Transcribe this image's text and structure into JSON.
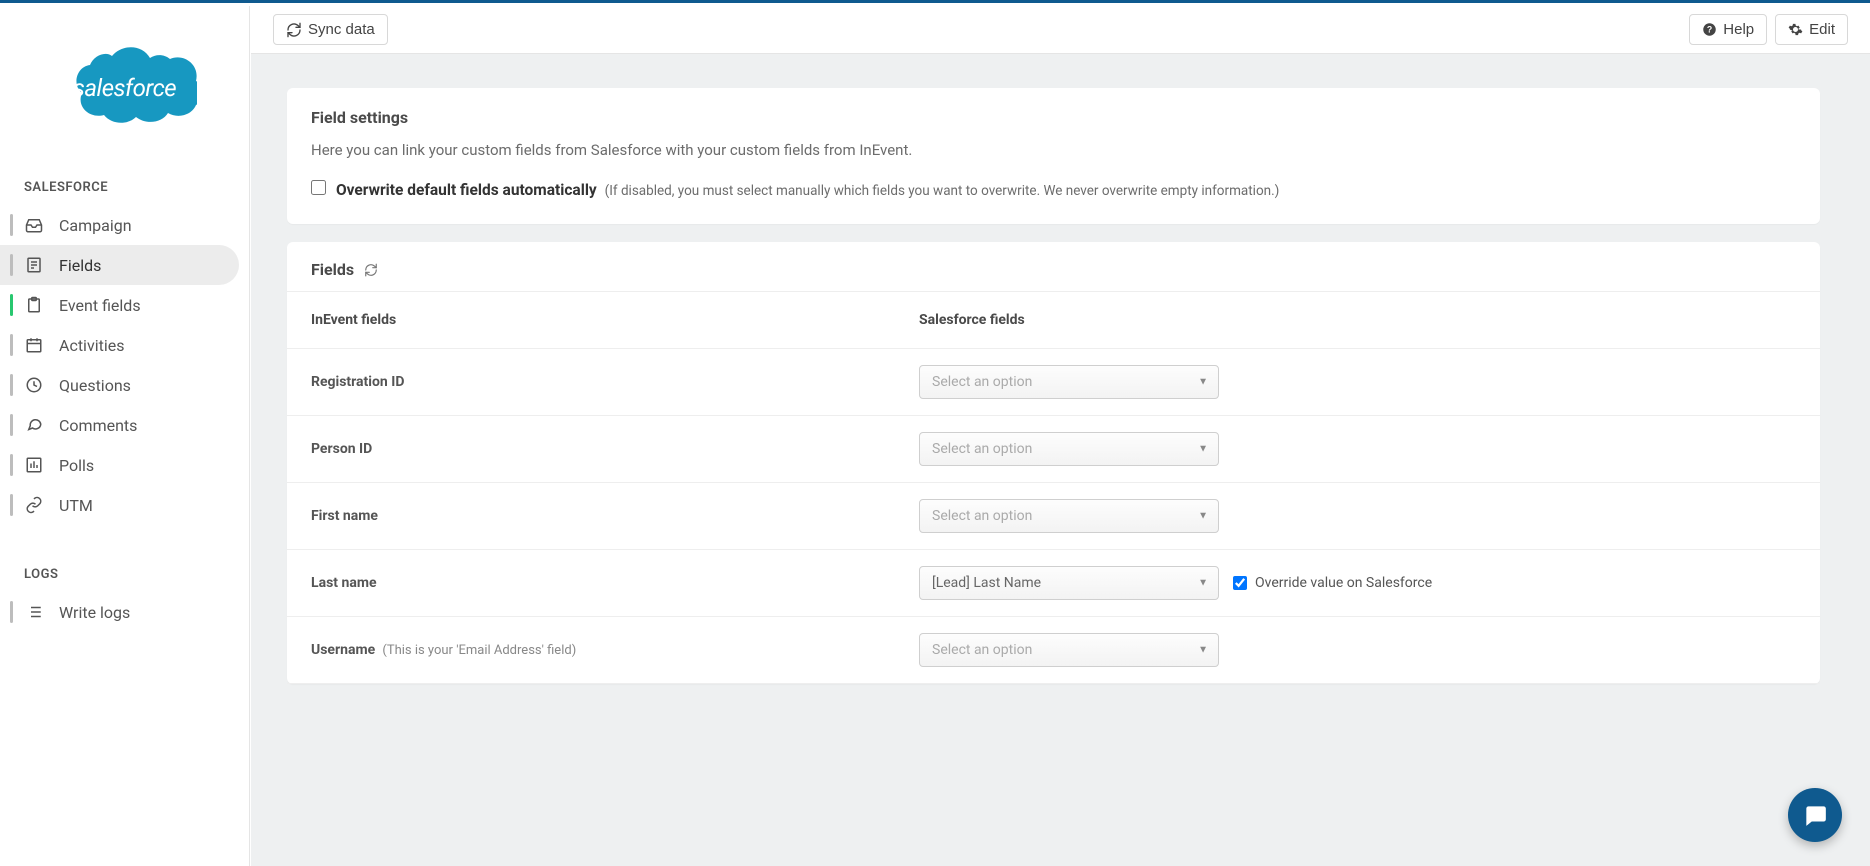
{
  "brand": {
    "logo_text": "salesforce",
    "color": "#1798c1"
  },
  "sidebar": {
    "section1_label": "SALESFORCE",
    "items": [
      {
        "icon": "inbox",
        "label": "Campaign",
        "active": false,
        "green": false
      },
      {
        "icon": "form",
        "label": "Fields",
        "active": true,
        "green": false
      },
      {
        "icon": "clipboard",
        "label": "Event fields",
        "active": false,
        "green": true
      },
      {
        "icon": "calendar",
        "label": "Activities",
        "active": false,
        "green": false
      },
      {
        "icon": "clock",
        "label": "Questions",
        "active": false,
        "green": false
      },
      {
        "icon": "comments",
        "label": "Comments",
        "active": false,
        "green": false
      },
      {
        "icon": "chart",
        "label": "Polls",
        "active": false,
        "green": false
      },
      {
        "icon": "link",
        "label": "UTM",
        "active": false,
        "green": false
      }
    ],
    "section2_label": "LOGS",
    "logs": [
      {
        "icon": "list",
        "label": "Write logs"
      }
    ]
  },
  "topbar": {
    "sync_label": "Sync data",
    "help_label": "Help",
    "edit_label": "Edit"
  },
  "settings_card": {
    "title": "Field settings",
    "description": "Here you can link your custom fields from Salesforce with your custom fields from InEvent.",
    "overwrite_label": "Overwrite default fields automatically",
    "overwrite_note": "(If disabled, you must select manually which fields you want to overwrite. We never overwrite empty information.)",
    "overwrite_checked": false
  },
  "fields_card": {
    "title": "Fields",
    "col_left": "InEvent fields",
    "col_right": "Salesforce fields",
    "select_placeholder": "Select an option",
    "override_label": "Override value on Salesforce",
    "rows": [
      {
        "label": "Registration ID",
        "hint": "",
        "value": "",
        "show_override": false,
        "override_checked": false
      },
      {
        "label": "Person ID",
        "hint": "",
        "value": "",
        "show_override": false,
        "override_checked": false
      },
      {
        "label": "First name",
        "hint": "",
        "value": "",
        "show_override": false,
        "override_checked": false
      },
      {
        "label": "Last name",
        "hint": "",
        "value": "[Lead] Last Name",
        "show_override": true,
        "override_checked": true
      },
      {
        "label": "Username",
        "hint": "(This is your 'Email Address' field)",
        "value": "",
        "show_override": false,
        "override_checked": false
      }
    ]
  }
}
